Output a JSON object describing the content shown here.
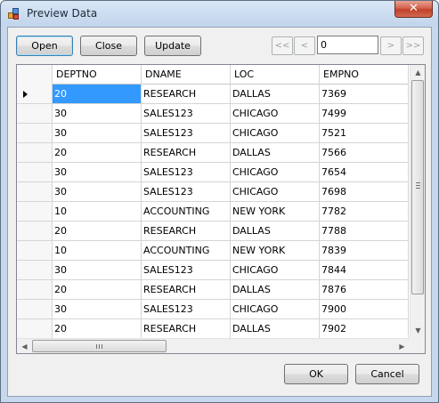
{
  "window": {
    "title": "Preview Data",
    "close_glyph": "✕"
  },
  "toolbar": {
    "open_label": "Open",
    "close_label": "Close",
    "update_label": "Update",
    "nav_first": "<<",
    "nav_prev": "<",
    "page_value": "0",
    "nav_next": ">",
    "nav_last": ">>"
  },
  "grid": {
    "columns": [
      "DEPTNO",
      "DNAME",
      "LOC",
      "EMPNO"
    ],
    "current_row_index": 0,
    "rows": [
      [
        "20",
        "RESEARCH",
        "DALLAS",
        "7369"
      ],
      [
        "30",
        "SALES123",
        "CHICAGO",
        "7499"
      ],
      [
        "30",
        "SALES123",
        "CHICAGO",
        "7521"
      ],
      [
        "20",
        "RESEARCH",
        "DALLAS",
        "7566"
      ],
      [
        "30",
        "SALES123",
        "CHICAGO",
        "7654"
      ],
      [
        "30",
        "SALES123",
        "CHICAGO",
        "7698"
      ],
      [
        "10",
        "ACCOUNTING",
        "NEW YORK",
        "7782"
      ],
      [
        "20",
        "RESEARCH",
        "DALLAS",
        "7788"
      ],
      [
        "10",
        "ACCOUNTING",
        "NEW YORK",
        "7839"
      ],
      [
        "30",
        "SALES123",
        "CHICAGO",
        "7844"
      ],
      [
        "20",
        "RESEARCH",
        "DALLAS",
        "7876"
      ],
      [
        "30",
        "SALES123",
        "CHICAGO",
        "7900"
      ],
      [
        "20",
        "RESEARCH",
        "DALLAS",
        "7902"
      ]
    ]
  },
  "footer": {
    "ok_label": "OK",
    "cancel_label": "Cancel"
  },
  "colors": {
    "selection": "#3399ff",
    "title_bar": "#c2d5ec",
    "close_button": "#c1412a"
  }
}
